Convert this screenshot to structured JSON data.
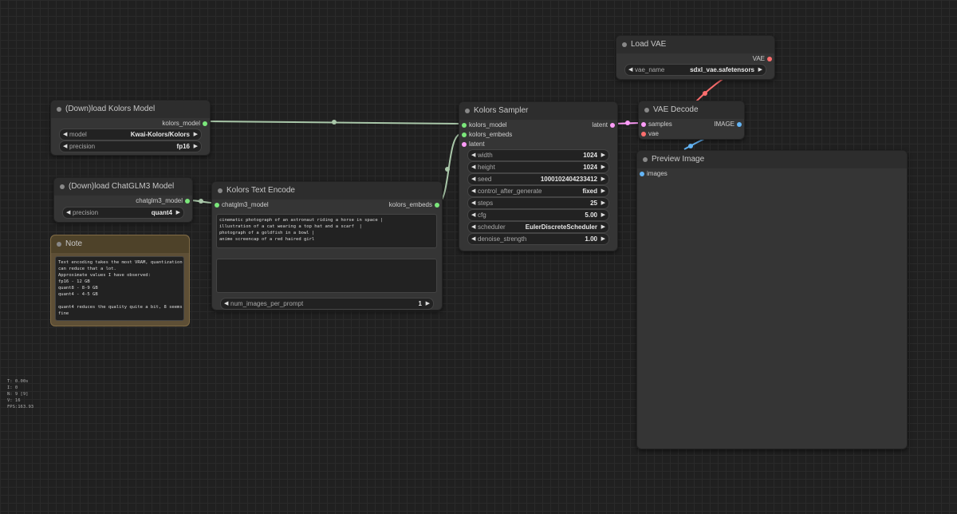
{
  "colors": {
    "model_socket": "#7be77b",
    "embeds_socket": "#7be77b",
    "latent_socket": "#ff9cf9",
    "vae_socket": "#ff6e6e",
    "image_socket": "#64b5f6",
    "wire_model": "#a9c7a9",
    "wire_vae": "#ff6e6e",
    "wire_image": "#64b5f6",
    "wire_latent": "#ff9cf9"
  },
  "nodes": {
    "load_kolors": {
      "title": "(Down)load Kolors Model",
      "output": "kolors_model",
      "widgets": [
        {
          "label": "model",
          "value": "Kwai-Kolors/Kolors"
        },
        {
          "label": "precision",
          "value": "fp16"
        }
      ]
    },
    "load_chatglm": {
      "title": "(Down)load ChatGLM3 Model",
      "output": "chatglm3_model",
      "widgets": [
        {
          "label": "precision",
          "value": "quant4"
        }
      ]
    },
    "note": {
      "title": "Note",
      "text": "Text encoding takes the most VRAM, quantization\ncan reduce that a lot.\nApproximate values I have observed:\nfp16 - 12 GB\nquant8 - 8-9 GB\nquant4 - 4-5 GB\n\nquant4 reduces the quality quite a bit, 8 seems\nfine"
    },
    "text_encode": {
      "title": "Kolors Text Encode",
      "input": "chatglm3_model",
      "output": "kolors_embeds",
      "prompt": "cinematic photograph of an astronaut riding a horse in space |\nillustration of a cat wearing a top hat and a scarf  |\nphotograph of a goldfish in a bowl |\nanime screencap of a red haired girl",
      "negative": "",
      "widgets": [
        {
          "label": "num_images_per_prompt",
          "value": "1"
        }
      ]
    },
    "sampler": {
      "title": "Kolors Sampler",
      "inputs": [
        "kolors_model",
        "kolors_embeds",
        "latent"
      ],
      "output": "latent",
      "widgets": [
        {
          "label": "width",
          "value": "1024"
        },
        {
          "label": "height",
          "value": "1024"
        },
        {
          "label": "seed",
          "value": "1000102404233412"
        },
        {
          "label": "control_after_generate",
          "value": "fixed"
        },
        {
          "label": "steps",
          "value": "25"
        },
        {
          "label": "cfg",
          "value": "5.00"
        },
        {
          "label": "scheduler",
          "value": "EulerDiscreteScheduler"
        },
        {
          "label": "denoise_strength",
          "value": "1.00"
        }
      ]
    },
    "load_vae": {
      "title": "Load VAE",
      "output": "VAE",
      "widgets": [
        {
          "label": "vae_name",
          "value": "sdxl_vae.safetensors"
        }
      ]
    },
    "vae_decode": {
      "title": "VAE Decode",
      "inputs": [
        "samples",
        "vae"
      ],
      "output": "IMAGE"
    },
    "preview": {
      "title": "Preview Image",
      "input": "images"
    }
  },
  "stats": [
    "T: 0.00s",
    "I: 0",
    "N: 9 [9]",
    "V: 16",
    "FPS:163.93"
  ]
}
